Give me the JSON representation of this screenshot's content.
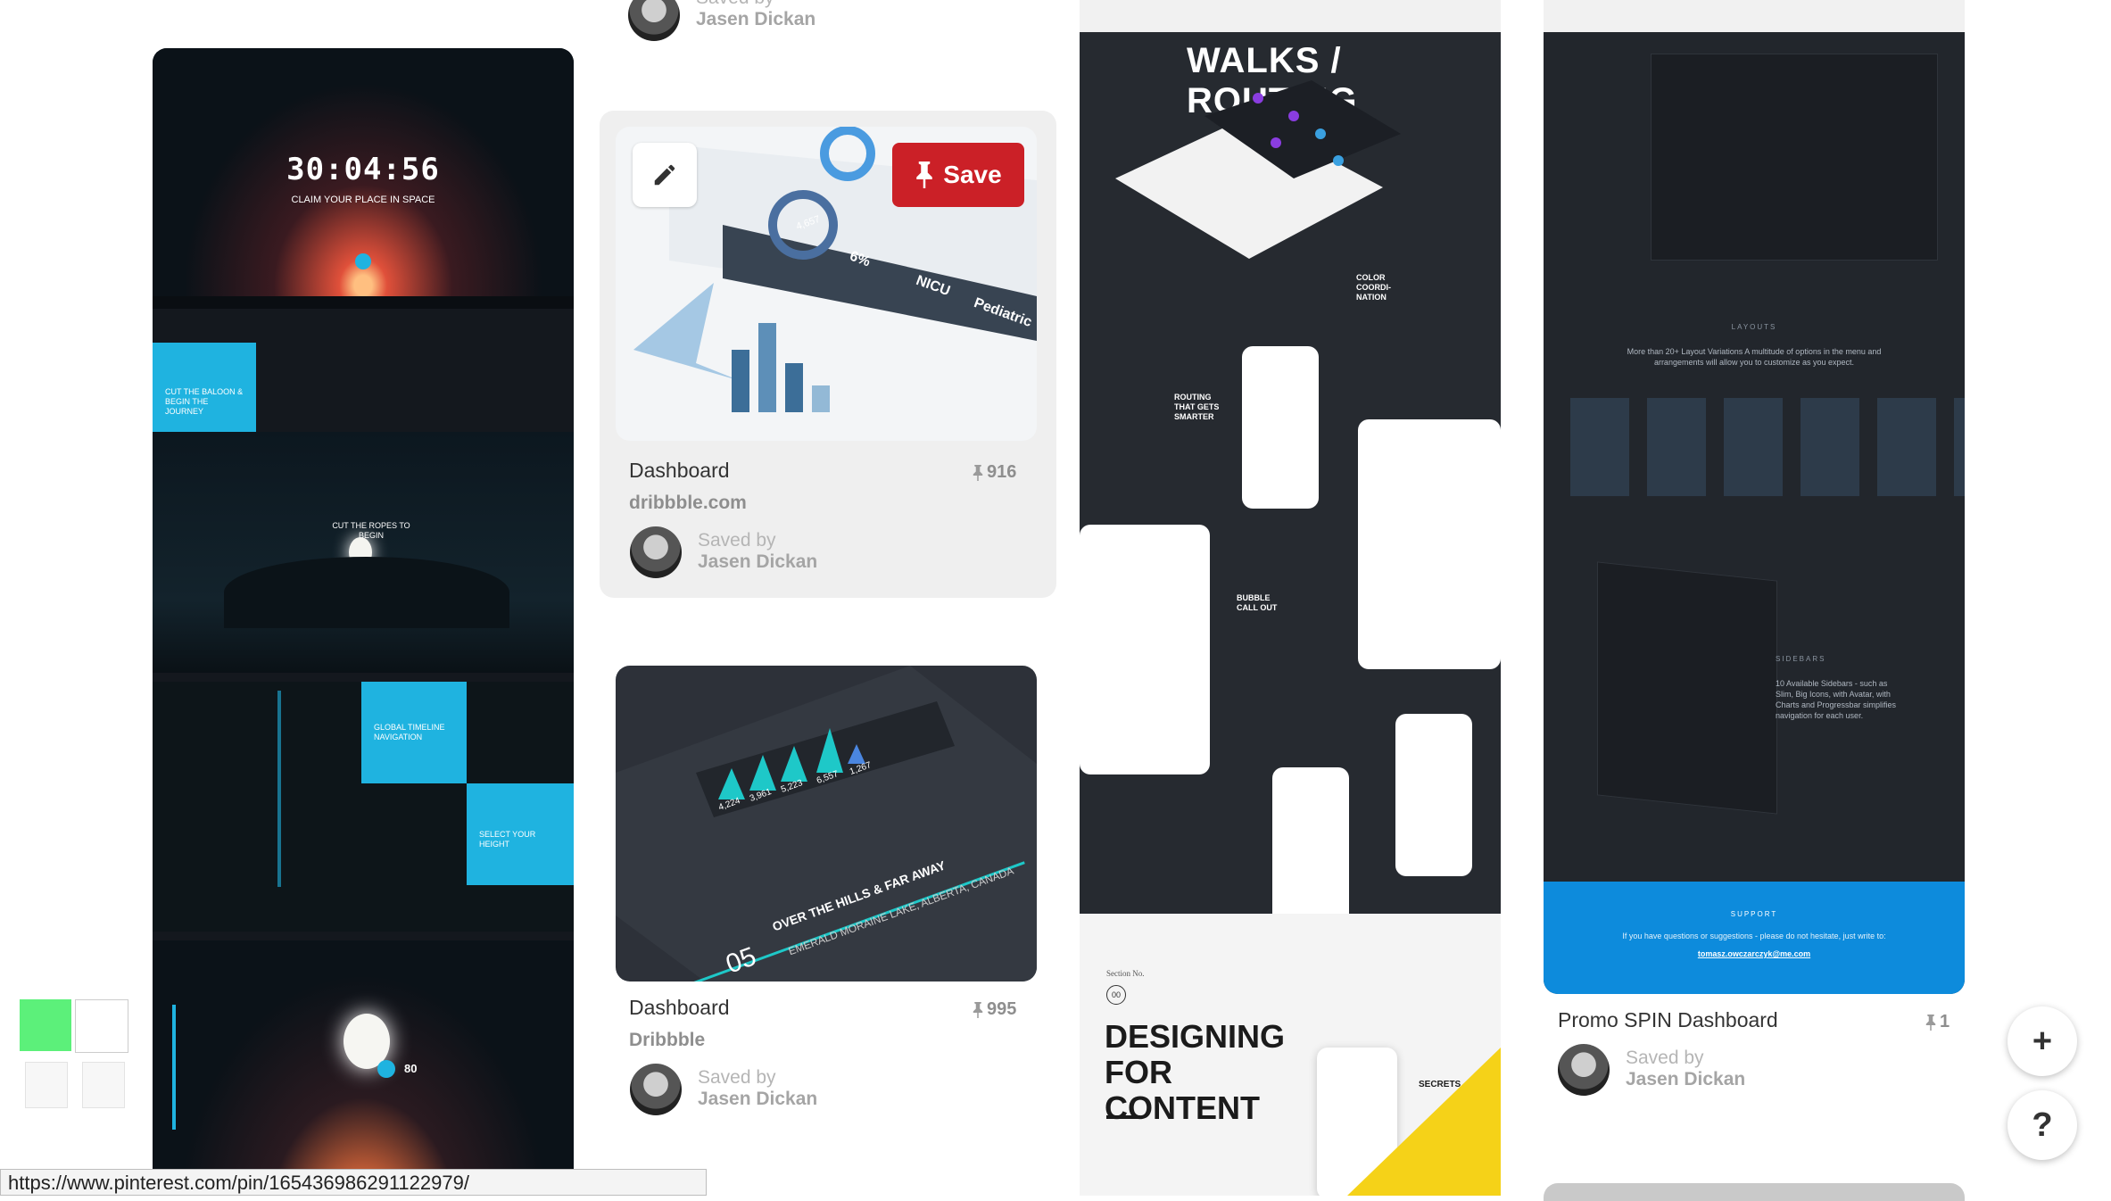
{
  "status_url": "https://www.pinterest.com/pin/165436986291122979/",
  "col1": {
    "hero_countdown": "30:04:56",
    "hero_tagline": "CLAIM YOUR PLACE IN SPACE",
    "panel1": "CUT THE BALOON & BEGIN THE JOURNEY",
    "panel2": "CUT THE ROPES TO BEGIN",
    "panel3": "GLOBAL TIMELINE NAVIGATION",
    "panel4": "SELECT YOUR HEIGHT",
    "height_value": "80"
  },
  "pins": [
    {
      "title": "Dashboard",
      "source": "dribbble.com",
      "count": "916",
      "saved_label": "Saved by",
      "user": "Jasen Dickan"
    },
    {
      "title": "Dashboard",
      "source": "Dribbble",
      "count": "995",
      "saved_label": "Saved by",
      "user": "Jasen Dickan"
    },
    {
      "title": "Promo SPIN Dashboard",
      "count": "1",
      "saved_label": "Saved by",
      "user": "Jasen Dickan"
    }
  ],
  "top_partial": {
    "line1": "Saved by",
    "line2": "Jasen Dickan"
  },
  "save_button": "Save",
  "walks": {
    "title": "WALKS / ROUTING",
    "color": "COLOR COORDI-NATION",
    "routing": "ROUTING THAT GETS SMARTER",
    "bubble": "BUBBLE CALL OUT",
    "section_label": "Section No.",
    "section_no": "00",
    "designing": "DESIGNING FOR CONTENT",
    "secrets": "SECRETS"
  },
  "spin": {
    "layouts_label": "LAYOUTS",
    "layouts_text": "More than 20+ Layout Variations A multitude of options in the menu and arrangements will allow you to customize as you expect.",
    "sidebars_label": "SIDEBARS",
    "sidebars_text": "10 Available Sidebars - such as Slim, Big Icons, with Avatar, with Charts and Progressbar simplifies navigation for each user.",
    "support_label": "SUPPORT",
    "support_text": "If you have questions or suggestions - please do not hesitate, just write to:",
    "support_email": "tomasz.owczarczyk@me.com"
  },
  "dash1_labels": {
    "stat": "4,657",
    "percent": "6%",
    "nicu": "NICU",
    "pediatric": "Pediatric"
  },
  "dash2_labels": {
    "v1": "4,224",
    "v2": "3,961",
    "v3": "5,223",
    "v4": "6,557",
    "v5": "1,267",
    "day": "05",
    "headline": "OVER THE HILLS & FAR AWAY",
    "sub": "EMERALD MORAINE LAKE, ALBERTA, CANADA"
  },
  "float_buttons": {
    "add": "+",
    "help": "?"
  },
  "colors": {
    "pinterest_red": "#cb2027",
    "cyan": "#1fb3e0",
    "spin_blue": "#0d8bdc"
  }
}
